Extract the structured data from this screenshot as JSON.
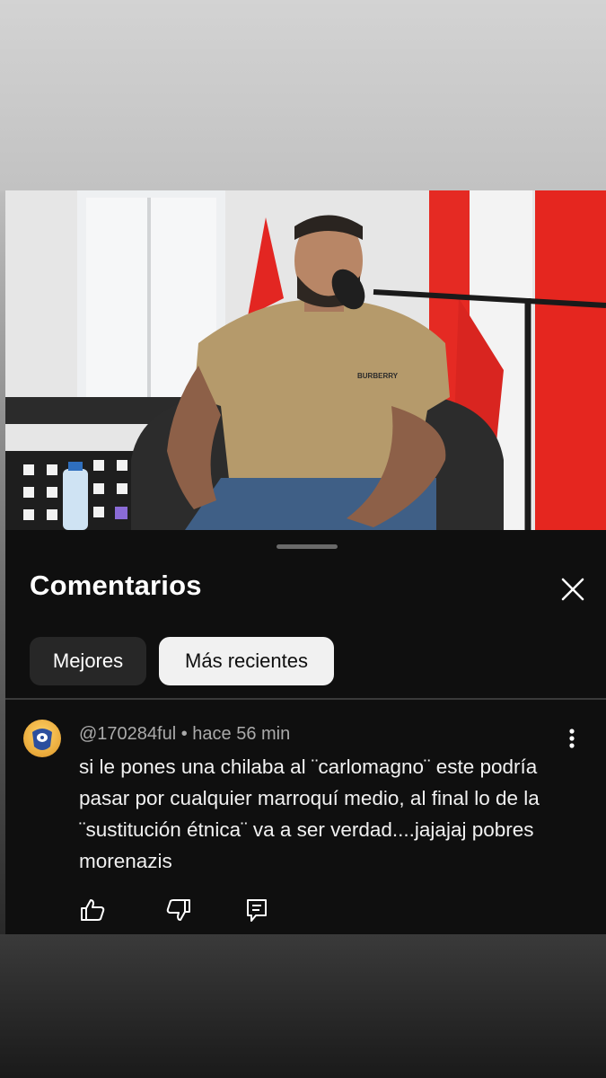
{
  "sheet": {
    "title": "Comentarios",
    "filters": [
      {
        "label": "Mejores",
        "selected": false
      },
      {
        "label": "Más recientes",
        "selected": true
      }
    ]
  },
  "comments": [
    {
      "author": "@170284ful",
      "separator": " • ",
      "time": "hace 56 min",
      "text": "si le pones una chilaba al  ¨carlomagno¨ este podría pasar por cualquier marroquí medio, al final lo de la ¨sustitución étnica¨ va a ser verdad....jajajaj pobres morenazis"
    }
  ],
  "video": {
    "shirt_brand": "BURBERRY"
  },
  "icons": {
    "close": "close-icon",
    "more": "more-vertical-icon",
    "like": "thumbs-up-icon",
    "dislike": "thumbs-down-icon",
    "reply": "reply-icon"
  },
  "colors": {
    "sheet_bg": "#0f0f0f",
    "chip_dark": "#272727",
    "chip_light": "#f1f1f1",
    "meta_text": "#aaaaaa"
  }
}
